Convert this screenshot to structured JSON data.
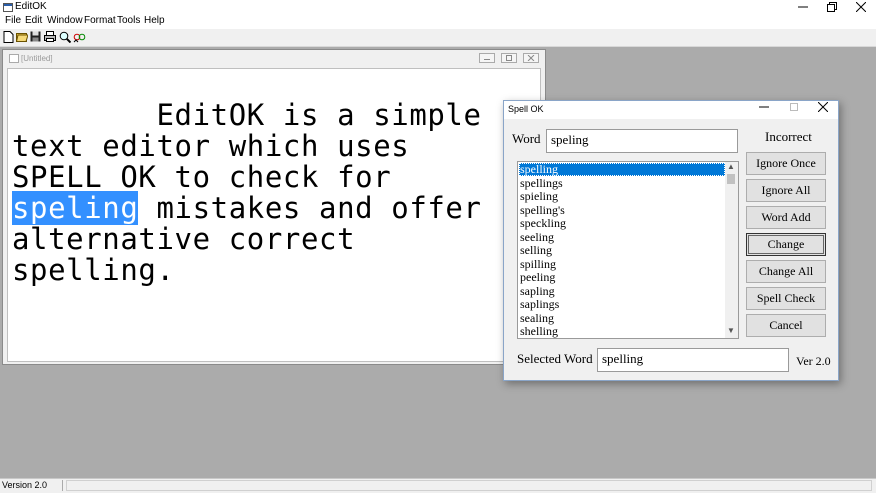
{
  "app": {
    "title": "EditOK"
  },
  "menu": {
    "items": [
      "File",
      "Edit",
      "Window",
      "Format",
      "Tools",
      "Help"
    ]
  },
  "toolbar": {
    "buttons": [
      "new-icon",
      "open-icon",
      "save-icon",
      "print-icon",
      "find-icon",
      "spell-check-icon"
    ]
  },
  "document": {
    "title": "[Untitled]",
    "text_before": "        EditOK is a simple text editor which uses SPELL_OK to check for ",
    "highlighted_word": "speling",
    "text_after": " mistakes and offer alternative correct spelling."
  },
  "spell_dialog": {
    "title": "Spell OK",
    "word_label": "Word",
    "word_value": "speling",
    "status": "Incorrect",
    "suggestions": [
      "spelling",
      "spellings",
      "spieling",
      "spelling's",
      "speckling",
      "seeling",
      "selling",
      "spilling",
      "peeling",
      "sapling",
      "saplings",
      "sealing",
      "shelling"
    ],
    "selected_index": 0,
    "buttons": {
      "ignore_once": "Ignore Once",
      "ignore_all": "Ignore All",
      "word_add": "Word Add",
      "change": "Change",
      "change_all": "Change All",
      "spell_check": "Spell Check",
      "cancel": "Cancel"
    },
    "selected_word_label": "Selected Word",
    "selected_word_value": "spelling",
    "version": "Ver 2.0"
  },
  "statusbar": {
    "version": "Version 2.0"
  },
  "colors": {
    "selection": "#0078d7",
    "highlight": "#3390ff",
    "workspace": "#ababab"
  }
}
